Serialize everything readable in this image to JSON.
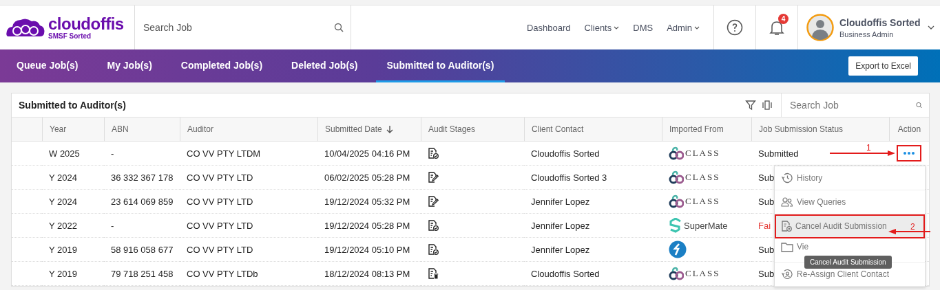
{
  "logo": {
    "name": "cloudoffis",
    "tagline": "SMSF Sorted"
  },
  "top_search": {
    "placeholder": "Search Job"
  },
  "nav": [
    {
      "label": "Dashboard",
      "dropdown": false
    },
    {
      "label": "Clients",
      "dropdown": true
    },
    {
      "label": "DMS",
      "dropdown": false
    },
    {
      "label": "Admin",
      "dropdown": true
    }
  ],
  "notifications": {
    "count": "4"
  },
  "user": {
    "name": "Cloudoffis Sorted",
    "role": "Business Admin"
  },
  "tabs": [
    {
      "label": "Queue Job(s)",
      "selected": false
    },
    {
      "label": "My Job(s)",
      "selected": false
    },
    {
      "label": "Completed Job(s)",
      "selected": false
    },
    {
      "label": "Deleted Job(s)",
      "selected": false
    },
    {
      "label": "Submitted to Auditor(s)",
      "selected": true
    }
  ],
  "export_button": "Export to Excel",
  "panel": {
    "title": "Submitted to Auditor(s)",
    "search": {
      "placeholder": "Search Job"
    }
  },
  "table": {
    "columns": [
      "Year",
      "ABN",
      "Auditor",
      "Submitted Date",
      "Audit Stages",
      "Client Contact",
      "Imported From",
      "Job Submission Status",
      "Action"
    ],
    "rows": [
      {
        "year": "W 2025",
        "abn": "-",
        "auditor": "CO VV PTY LTDM",
        "date": "10/04/2025 04:16 PM",
        "audit_stage": {
          "kind": "check"
        },
        "contact": "Cloudoffis Sorted",
        "imported": {
          "kind": "class",
          "label": "CLASS"
        },
        "status": "Submitted",
        "failed": false,
        "menu_open": true
      },
      {
        "year": "Y 2024",
        "abn": "36 332 367 178",
        "auditor": "CO VV PTY LTD",
        "date": "06/02/2025 05:28 PM",
        "audit_stage": {
          "kind": "edit"
        },
        "contact": "Cloudoffis Sorted 3",
        "imported": {
          "kind": "class",
          "label": "CLASS"
        },
        "status": "Sub",
        "failed": false
      },
      {
        "year": "Y 2024",
        "abn": "23 614 069 859",
        "auditor": "CO VV PTY LTD",
        "date": "19/12/2024 05:32 PM",
        "audit_stage": {
          "kind": "edit"
        },
        "contact": "Jennifer Lopez",
        "imported": {
          "kind": "class",
          "label": "CLASS"
        },
        "status": "Sub",
        "failed": false
      },
      {
        "year": "Y 2022",
        "abn": "-",
        "auditor": "CO VV PTY LTD",
        "date": "19/12/2024 05:28 PM",
        "audit_stage": {
          "kind": "check"
        },
        "contact": "Jennifer Lopez",
        "imported": {
          "kind": "supermate",
          "label": "SuperMate"
        },
        "status": "Fai",
        "failed": true
      },
      {
        "year": "Y 2019",
        "abn": "58 916 058 677",
        "auditor": "CO VV PTY LTD",
        "date": "19/12/2024 05:10 PM",
        "audit_stage": {
          "kind": "check"
        },
        "contact": "Jennifer Lopez",
        "imported": {
          "kind": "circle"
        },
        "status": "Sub",
        "failed": false
      },
      {
        "year": "Y 2019",
        "abn": "79 718 251 458",
        "auditor": "CO VV PTY LTDb",
        "date": "18/12/2024 08:13 PM",
        "audit_stage": {
          "kind": "delete"
        },
        "contact": "Cloudoffis Sorted",
        "imported": {
          "kind": "class",
          "label": "CLASS"
        },
        "status": "Sub",
        "failed": false
      }
    ]
  },
  "action_menu": [
    {
      "label": "History",
      "kind": "history",
      "selected": false
    },
    {
      "label": "View Queries",
      "kind": "users",
      "selected": false
    },
    {
      "label": "Cancel Audit Submission",
      "kind": "cancel",
      "selected": true
    },
    {
      "label": "Vie",
      "kind": "folder",
      "selected": false
    },
    {
      "label": "Re-Assign Client Contact",
      "kind": "reassign",
      "selected": false
    }
  ],
  "tooltip": "Cancel Audit Submission",
  "annotations": [
    "1",
    "2"
  ]
}
